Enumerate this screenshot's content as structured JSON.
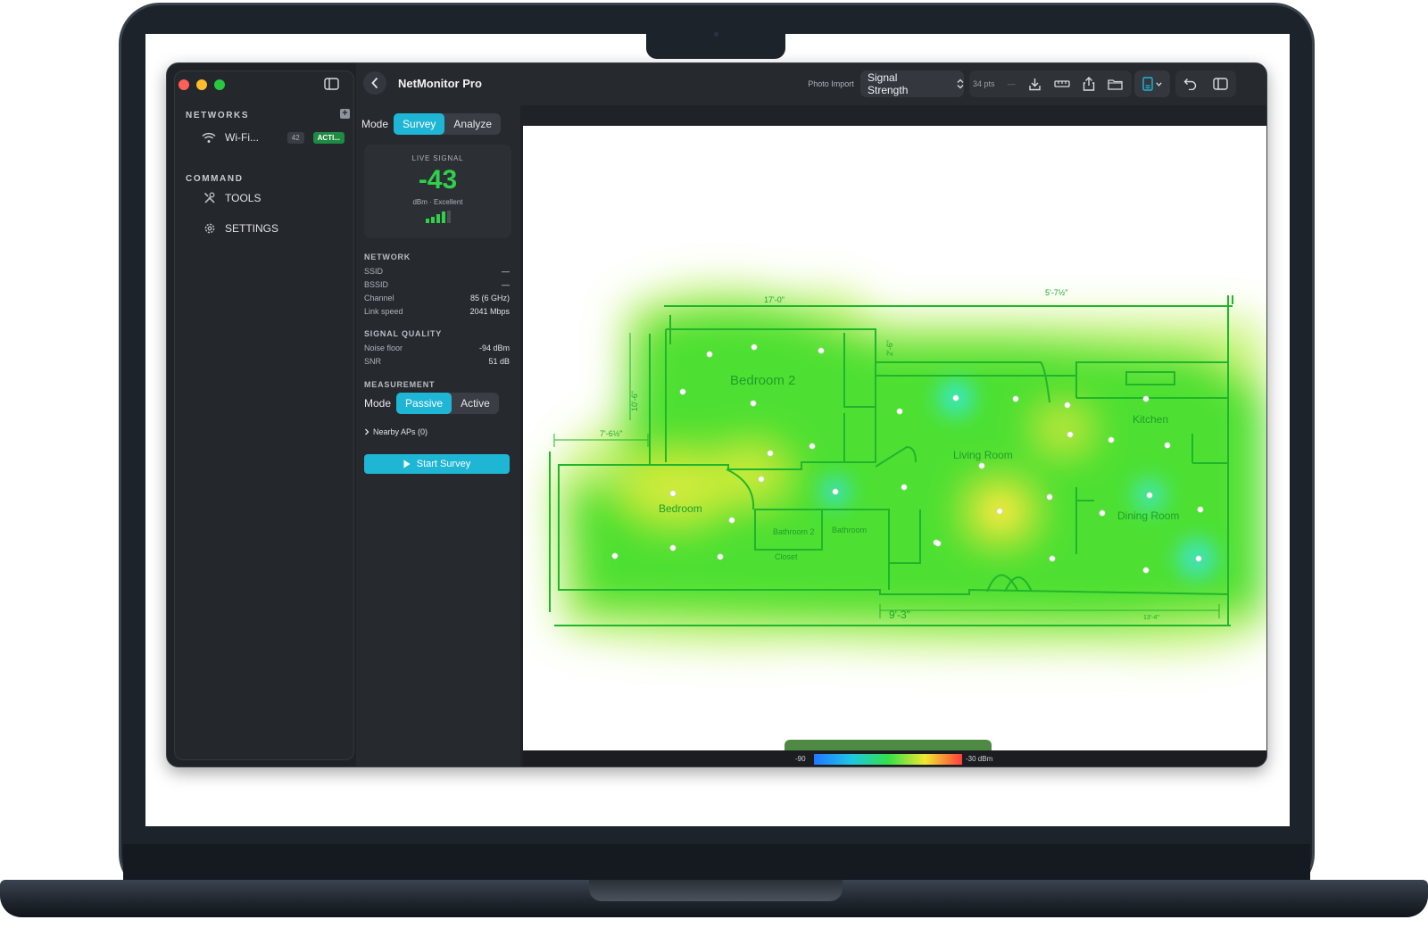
{
  "app": {
    "title": "NetMonitor Pro"
  },
  "sidebar": {
    "networks_label": "NETWORKS",
    "add_icon": "plus-icon",
    "networks": [
      {
        "name": "Wi-Fi...",
        "count": "42",
        "status": "ACTI..."
      }
    ],
    "command_label": "COMMAND",
    "items": [
      {
        "label": "TOOLS",
        "icon": "tools-icon"
      },
      {
        "label": "SETTINGS",
        "icon": "gear-icon"
      }
    ]
  },
  "toolbar": {
    "photo_import": "Photo Import",
    "layer_select": "Signal Strength",
    "points_count": "34 pts",
    "points_dash": "—"
  },
  "mode": {
    "label": "Mode",
    "options": [
      "Survey",
      "Analyze"
    ],
    "selected": "Survey"
  },
  "live_signal": {
    "label": "LIVE SIGNAL",
    "value": "-43",
    "unit_quality": "dBm · Excellent",
    "bars": 4
  },
  "network": {
    "header": "NETWORK",
    "rows": [
      {
        "label": "SSID",
        "value": "—"
      },
      {
        "label": "BSSID",
        "value": "—"
      },
      {
        "label": "Channel",
        "value": "85 (6 GHz)"
      },
      {
        "label": "Link speed",
        "value": "2041 Mbps"
      }
    ]
  },
  "signal_quality": {
    "header": "SIGNAL QUALITY",
    "rows": [
      {
        "label": "Noise floor",
        "value": "-94 dBm"
      },
      {
        "label": "SNR",
        "value": "51 dB"
      }
    ]
  },
  "measurement": {
    "header": "MEASUREMENT",
    "label": "Mode",
    "options": [
      "Passive",
      "Active"
    ],
    "selected": "Passive"
  },
  "nearby_aps": "Nearby APs (0)",
  "start_button": "Start Survey",
  "floorplan": {
    "rooms": [
      "Bedroom 2",
      "Living Room",
      "Kitchen",
      "Bedroom",
      "Bathroom 2",
      "Bathroom",
      "Closet",
      "Dining Room"
    ],
    "dimensions": [
      "17'-0\"",
      "5'-7½\"",
      "10'-6\"",
      "7'-6½\"",
      "2'-6\"",
      "9'-3\"",
      "13'-4\""
    ]
  },
  "legend": {
    "min": "-90",
    "max": "-30 dBm"
  },
  "colors": {
    "accent": "#1fb6d6",
    "signal_green": "#2fd04a",
    "heat_green": "#35e02a",
    "active_badge": "#1f8a43"
  }
}
